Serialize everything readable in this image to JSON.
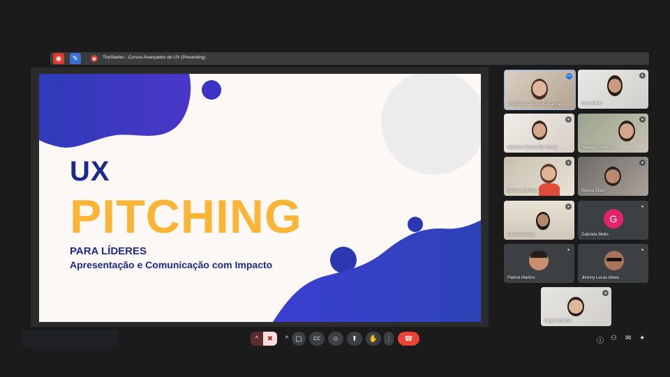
{
  "meeting_title": "TheStarter - Cursos Avançados de UX (Presenting)",
  "slide": {
    "line1": "UX",
    "line2": "PITCHING",
    "line3": "PARA LÍDERES",
    "line4": "Apresentação e Comunicação com Impacto"
  },
  "participants": [
    {
      "name": "TheStarter - Cursos Avançad...",
      "mic": "•••"
    },
    {
      "name": "Aline Mello",
      "mic": "●"
    },
    {
      "name": "Vanessa Gomes De Souza",
      "mic": "●"
    },
    {
      "name": "Rafaela Sarmento",
      "mic": "●"
    },
    {
      "name": "Bárbara Barbiga",
      "mic": "●"
    },
    {
      "name": "Bianca Elias",
      "mic": "●"
    },
    {
      "name": "Camila Santos",
      "mic": "●"
    },
    {
      "name": "Gabriela Mello",
      "mic": "●",
      "initial": "G"
    },
    {
      "name": "Patrick Martins",
      "mic": "●"
    },
    {
      "name": "Jhonny Lucas Abreu",
      "mic": "●"
    },
    {
      "name": "Miguel Coelho",
      "mic": "●"
    }
  ],
  "icons": {
    "record": "◉",
    "pen": "✎",
    "present": "▣",
    "chevron": "^",
    "mic_off": "✖",
    "camera": "▢",
    "captions": "CC",
    "emoji": "☺",
    "share": "⬆",
    "hand": "✋",
    "more": "⋮",
    "end_call": "☎",
    "info": "ⓘ",
    "people": "⚇",
    "chat": "✉",
    "activities": "✦"
  },
  "colors": {
    "accent_blue": "#1d2a8c",
    "accent_yellow": "#fbb536",
    "end_call_red": "#ea4335"
  }
}
